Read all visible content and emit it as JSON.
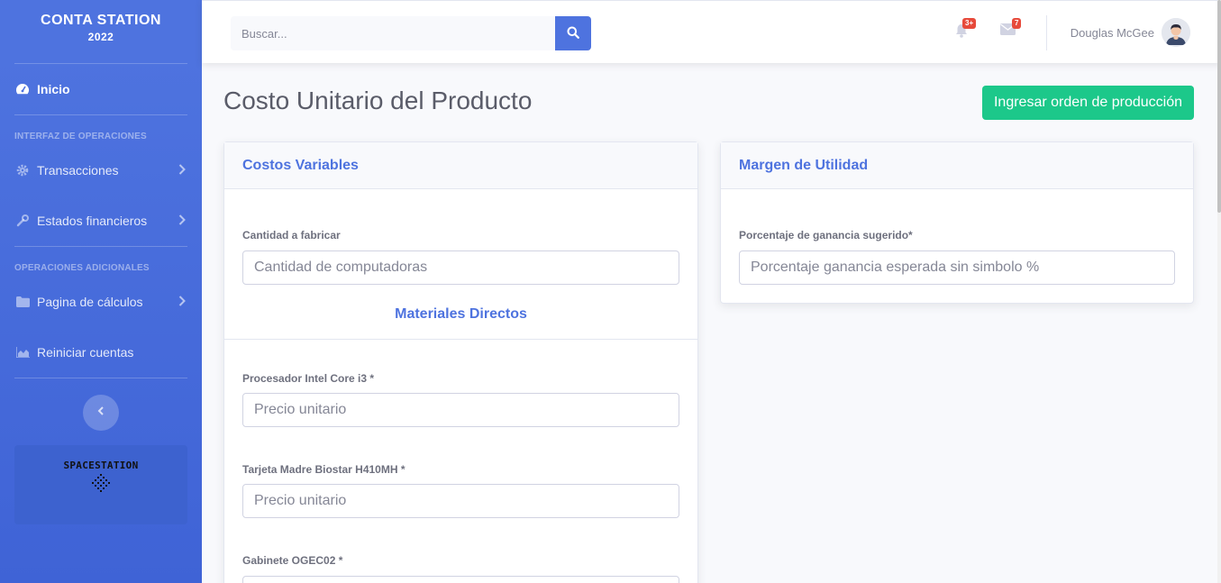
{
  "sidebar": {
    "brand_line1": "CONTA STATION",
    "brand_line2": "2022",
    "items": [
      {
        "label": "Inicio",
        "icon": "tachometer-icon"
      },
      {
        "label": "Transacciones",
        "icon": "cog-icon"
      },
      {
        "label": "Estados financieros",
        "icon": "wrench-icon"
      },
      {
        "label": "Pagina de cálculos",
        "icon": "folder-icon"
      },
      {
        "label": "Reiniciar cuentas",
        "icon": "chart-area-icon"
      }
    ],
    "heading1": "INTERFAZ DE OPERACIONES",
    "heading2": "OPERACIONES ADICIONALES",
    "promo_name": "SPACESTATION"
  },
  "topbar": {
    "search_placeholder": "Buscar...",
    "alerts_count": "3+",
    "messages_count": "7",
    "user_name": "Douglas McGee"
  },
  "page": {
    "title": "Costo Unitario del Producto",
    "action_button": "Ingresar orden de producción"
  },
  "costos_card": {
    "title": "Costos Variables",
    "cantidad_label": "Cantidad a fabricar",
    "cantidad_placeholder": "Cantidad de computadoras",
    "materiales_title": "Materiales Directos",
    "fields": [
      {
        "label": "Procesador Intel Core i3 *",
        "placeholder": "Precio unitario"
      },
      {
        "label": "Tarjeta Madre Biostar H410MH *",
        "placeholder": "Precio unitario"
      },
      {
        "label": "Gabinete OGEC02 *",
        "placeholder": ""
      }
    ]
  },
  "margen_card": {
    "title": "Margen de Utilidad",
    "label": "Porcentaje de ganancia sugerido*",
    "placeholder": "Porcentaje ganancia esperada sin simbolo %"
  },
  "colors": {
    "primary": "#4e73df",
    "success": "#1cc88a",
    "danger": "#e74a3b"
  }
}
